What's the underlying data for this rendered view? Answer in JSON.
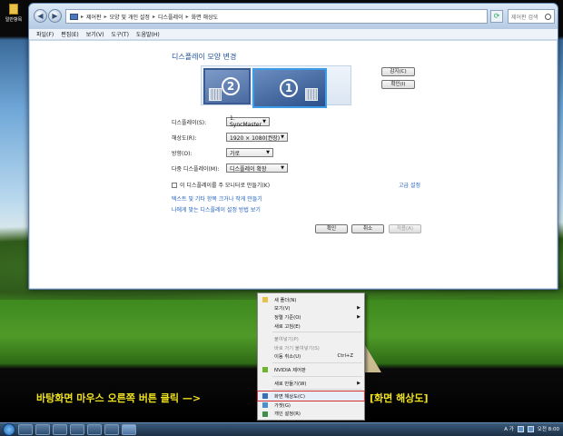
{
  "desktop": {
    "icon_label": "일반항목"
  },
  "window": {
    "address": [
      "제어판",
      "모양 및 개인 설정",
      "디스플레이",
      "화면 해상도"
    ],
    "search_placeholder": "제어판 검색",
    "menu": [
      "파일(F)",
      "편집(E)",
      "보기(V)",
      "도구(T)",
      "도움말(H)"
    ]
  },
  "display": {
    "heading": "디스플레이 모양 변경",
    "monitor_1": "1",
    "monitor_2": "2",
    "detect_button": "감지(C)",
    "identify_button": "확인(I)",
    "fields": [
      {
        "label": "디스플레이(S):",
        "value": "1. SyncMaster"
      },
      {
        "label": "해상도(R):",
        "value": "1920 × 1080(권장)"
      },
      {
        "label": "방향(O):",
        "value": "가로"
      },
      {
        "label": "다중 디스플레이(M):",
        "value": "디스플레이 확장"
      }
    ],
    "primary_checkbox": "이 디스플레이를 주 모니터로 만들기(K)",
    "advanced_link": "고급 설정",
    "link_1": "텍스트 및 기타 항목 크거나 작게 만들기",
    "link_2": "나에게 맞는 디스플레이 설정 방법 보기",
    "ok_button": "확인",
    "cancel_button": "취소",
    "apply_button": "적용(A)"
  },
  "context_menu": {
    "items": [
      {
        "label": "새 폴더(N)"
      },
      {
        "label": "보기(V)",
        "submenu": "true"
      },
      {
        "label": "정렬 기준(O)",
        "submenu": "true"
      },
      {
        "label": "새로 고침(E)"
      },
      {
        "label": "붙여넣기(P)",
        "disabled": "true"
      },
      {
        "label": "바로 가기 붙여넣기(S)",
        "disabled": "true"
      },
      {
        "label": "이동 취소(U)",
        "shortcut": "Ctrl+Z"
      },
      {
        "label": "NVIDIA 제어판"
      },
      {
        "label": "새로 만들기(W)",
        "submenu": "true"
      },
      {
        "label": "화면 해상도(C)",
        "highlighted": "true"
      },
      {
        "label": "가젯(G)"
      },
      {
        "label": "개인 설정(R)"
      }
    ]
  },
  "caption": {
    "instruction": "바탕화면 마우스 오른쪽 버튼 클릭 —>",
    "target": "[화면 해상도]"
  },
  "taskbar": {
    "time": "오전 8:00",
    "ime": "A 가"
  },
  "colors": {
    "caption": "#f0e21f",
    "highlight_outline": "#d43030",
    "link": "#1f5fbf"
  }
}
